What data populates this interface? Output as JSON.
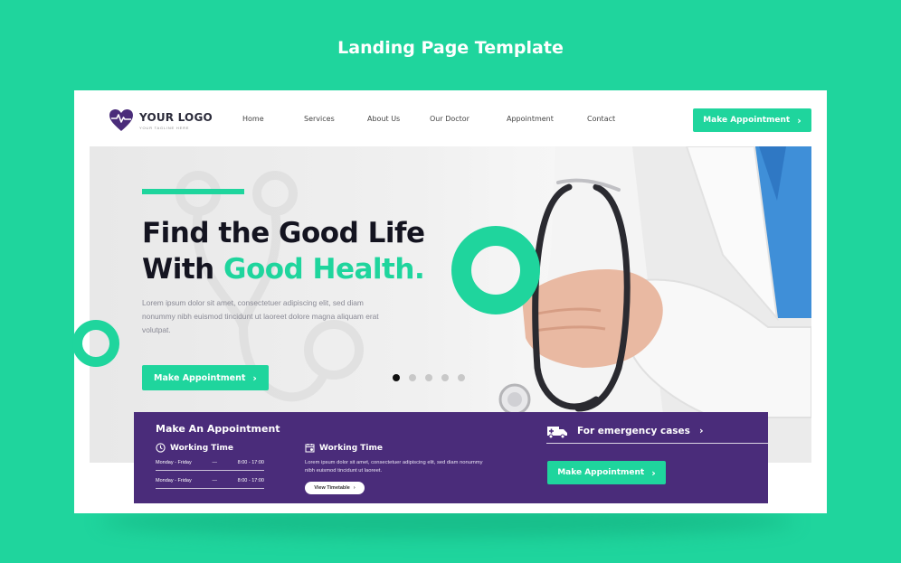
{
  "page": {
    "title": "Landing Page Template"
  },
  "logo": {
    "main_prefix": "YOUR ",
    "main_bold": "LOGO",
    "tagline": "YOUR TAGLINE HERE"
  },
  "nav": {
    "links": [
      "Home",
      "Services",
      "About Us",
      "Our Doctor",
      "Appointment",
      "Contact"
    ],
    "cta": "Make Appointment"
  },
  "hero": {
    "headline_line1": "Find the Good Life",
    "headline_line2_plain": "With ",
    "headline_line2_accent": "Good Health.",
    "description": "Lorem ipsum dolor sit amet, consectetuer adipiscing elit, sed diam nonummy nibh euismod tincidunt ut laoreet dolore magna aliquam erat volutpat.",
    "cta": "Make Appointment",
    "slides_total": 5,
    "slide_active": 1
  },
  "appointment_panel": {
    "title": "Make An Appointment",
    "working_time_label": "Working Time",
    "schedule": [
      {
        "days": "Monday - Friday",
        "dash": "—",
        "hours": "8:00 - 17:00"
      },
      {
        "days": "Monday - Friday",
        "dash": "—",
        "hours": "8:00 - 17:00"
      }
    ],
    "second_label": "Working Time",
    "second_desc": "Lorem ipsum dolor sit amet, consectetuer adipiscing elit, sed diam nonummy nibh euismod tincidunt ut laoreet.",
    "timetable_btn": "View Timetable",
    "emergency_label": "For emergency cases",
    "emergency_cta": "Make Appointment"
  },
  "colors": {
    "accent": "#1fd59d",
    "purple": "#4a2c7a",
    "dark": "#141420"
  }
}
